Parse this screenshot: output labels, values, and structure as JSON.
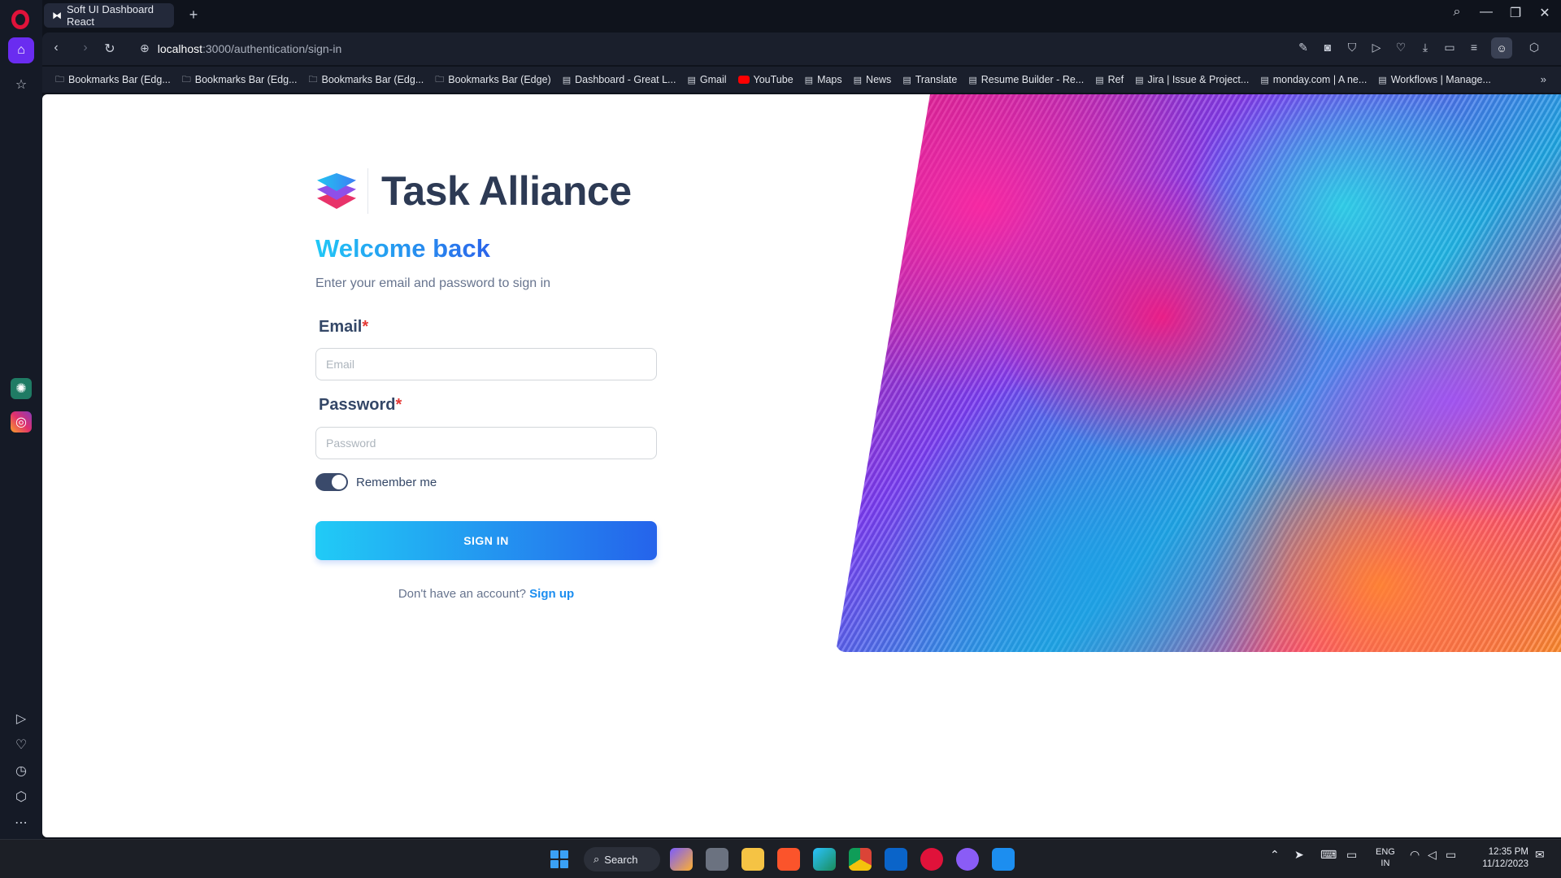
{
  "browser": {
    "tab_title": "Soft UI Dashboard React",
    "new_tab": "+",
    "url_host": "localhost",
    "url_path": ":3000/authentication/sign-in"
  },
  "bookmarks": [
    {
      "label": "Bookmarks Bar (Edg...",
      "icon": "folder-icon"
    },
    {
      "label": "Bookmarks Bar (Edg...",
      "icon": "folder-icon"
    },
    {
      "label": "Bookmarks Bar (Edg...",
      "icon": "folder-icon"
    },
    {
      "label": "Bookmarks Bar (Edge)",
      "icon": "folder-icon"
    },
    {
      "label": "Dashboard - Great L...",
      "icon": "page-icon"
    },
    {
      "label": "Gmail",
      "icon": "page-icon"
    },
    {
      "label": "YouTube",
      "icon": "youtube-icon"
    },
    {
      "label": "Maps",
      "icon": "page-icon"
    },
    {
      "label": "News",
      "icon": "page-icon"
    },
    {
      "label": "Translate",
      "icon": "page-icon"
    },
    {
      "label": "Resume Builder - Re...",
      "icon": "page-icon"
    },
    {
      "label": "Ref",
      "icon": "page-icon"
    },
    {
      "label": "Jira | Issue & Project...",
      "icon": "page-icon"
    },
    {
      "label": "monday.com | A ne...",
      "icon": "page-icon"
    },
    {
      "label": "Workflows | Manage...",
      "icon": "page-icon"
    }
  ],
  "login": {
    "brand_name": "Task Alliance",
    "welcome": "Welcome back",
    "subtitle": "Enter your email and password to sign in",
    "email_label": "Email",
    "email_placeholder": "Email",
    "password_label": "Password",
    "password_placeholder": "Password",
    "required_mark": "*",
    "remember_label": "Remember me",
    "remember_on": true,
    "signin_button": "SIGN IN",
    "signup_prompt": "Don't have an account?",
    "signup_link": "Sign up"
  },
  "taskbar": {
    "search_label": "Search",
    "lang_line1": "ENG",
    "lang_line2": "IN",
    "time": "12:35 PM",
    "date": "11/12/2023"
  },
  "colors": {
    "accent": "#2563eb",
    "accent_light": "#21cbf6",
    "heading": "#344767",
    "required": "#e53935",
    "opera_active": "#6a2cf0"
  }
}
